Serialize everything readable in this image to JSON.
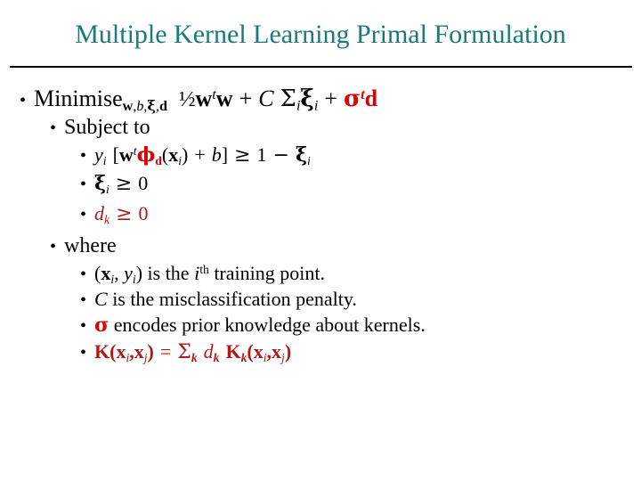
{
  "slide": {
    "title": "Multiple Kernel Learning Primal Formulation",
    "colors": {
      "title": "#1a7a78",
      "text": "#000000",
      "bright_red": "#dd0000",
      "dark_red": "#b01818",
      "rule": "#000000"
    }
  },
  "bullets": {
    "minimise": {
      "label": "Minimise",
      "subscript": "w,b,ξ,d",
      "objective_half": "½",
      "objective_wtw": "w",
      "objective_t": "t",
      "objective_w2": "w",
      "plus1": "+",
      "C": "C",
      "sigma_sum": "Σ",
      "sum_index": "i",
      "xi": "ξ",
      "xi_index": "i",
      "plus2": "+",
      "sigma_vec": "σ",
      "sigma_t": "t",
      "d_vec": "d",
      "full_text": "Minimise_{w,b,ξ,d}  ½wᵗw + C Σᵢξᵢ + σᵗd"
    },
    "subject_to": "Subject to",
    "constraint1": {
      "y": "y",
      "y_sub": "i",
      "open": "[",
      "w": "w",
      "w_sup": "t",
      "phi": "ϕ",
      "phi_sub": "d",
      "paren_open": "(",
      "x": "x",
      "x_sub": "i",
      "paren_close": ")",
      "plus": "+",
      "b": "b",
      "close": "]",
      "ge": "≥",
      "one": "1",
      "minus": "−",
      "xi": "ξ",
      "xi_sub": "i",
      "full_text": "yᵢ [wᵗϕₐ(xᵢ) + b] ≥ 1 − ξᵢ"
    },
    "constraint2": {
      "xi": "ξ",
      "xi_sub": "i",
      "ge": "≥",
      "zero": "0",
      "full_text": "ξᵢ ≥ 0"
    },
    "constraint3": {
      "d": "d",
      "d_sub": "k",
      "ge": "≥",
      "zero": "0",
      "full_text": "dₖ ≥ 0"
    },
    "where": "where",
    "where1": {
      "paren_open": "(",
      "x": "x",
      "x_sub": "i",
      "comma": ", ",
      "y": "y",
      "y_sub": "i",
      "paren_close": ")",
      "text_a": " is the ",
      "i": "i",
      "th": "th",
      "text_b": " training point.",
      "full_text": "(xᵢ, yᵢ) is the iᵗʰ training point."
    },
    "where2": {
      "C": "C",
      "text": " is the misclassification penalty.",
      "full_text": "C is the misclassification penalty."
    },
    "where3": {
      "sigma": "σ",
      "text": " encodes prior knowledge about kernels.",
      "full_text": "σ encodes prior knowledge about kernels."
    },
    "where4": {
      "K": "K",
      "p1": "(",
      "x1": "x",
      "x1_sub": "i",
      "comma": ",",
      "x2": "x",
      "x2_sub": "j",
      "p2": ")",
      "eq": "=",
      "sum": "Σ",
      "sum_sub": "k",
      "d": "d",
      "d_sub": "k",
      "K2": "K",
      "K2_sub": "k",
      "p3": "(",
      "x3": "x",
      "x3_sub": "i",
      "comma2": ",",
      "x4": "x",
      "x4_sub": "j",
      "p4": ")",
      "full_text": "K(xᵢ,xⱼ) = Σₖ dₖ Kₖ(xᵢ,xⱼ)"
    }
  },
  "glyphs": {
    "bullet": "•"
  }
}
